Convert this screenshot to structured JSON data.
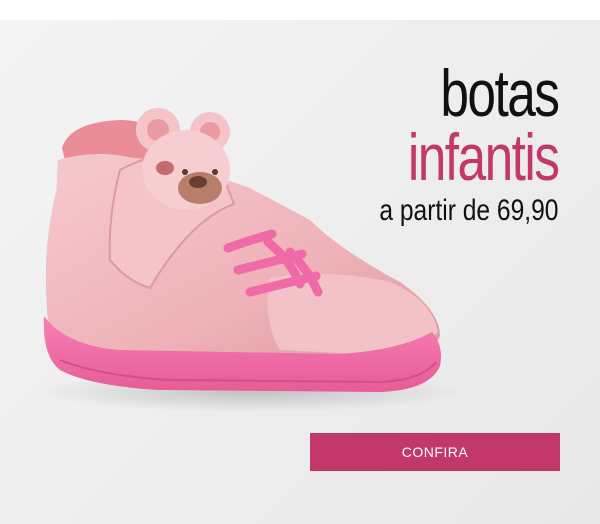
{
  "headline": {
    "line1": "botas",
    "line2": "infantis",
    "price": "a partir de 69,90"
  },
  "cta": {
    "label": "CONFIRA"
  },
  "colors": {
    "accent": "#c3386a",
    "sole": "#ee6fa6",
    "shoe": "#f0b8bd"
  },
  "image": {
    "subject": "pink-kids-boot-with-bear-face"
  }
}
